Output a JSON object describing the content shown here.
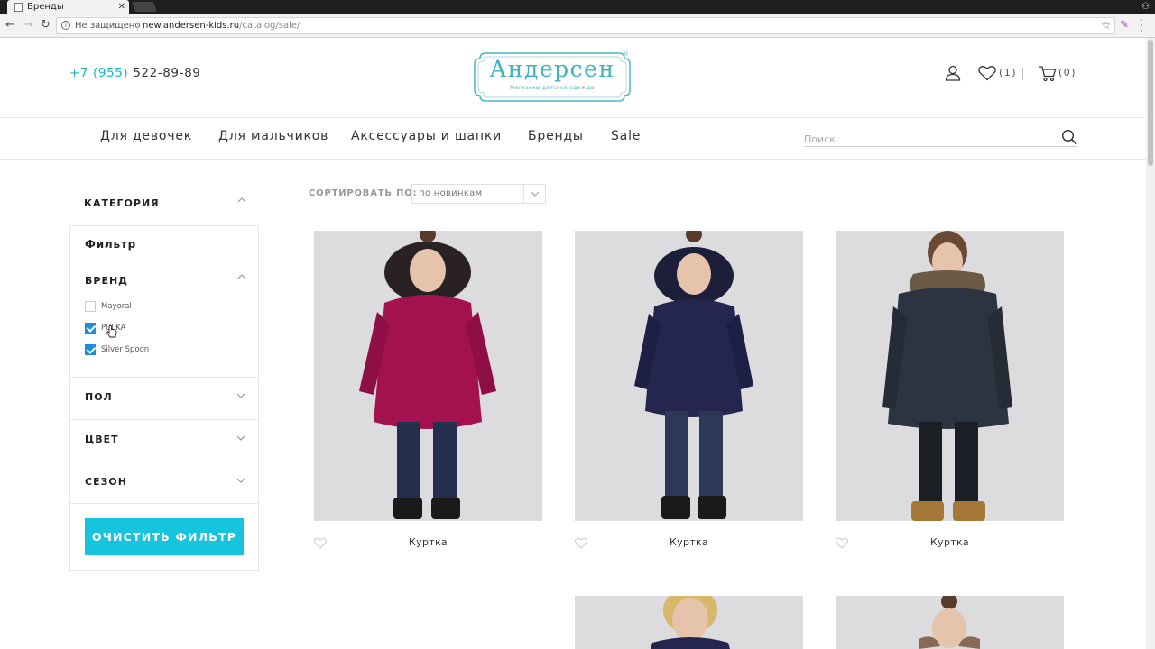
{
  "browser": {
    "tab_title": "Бренды",
    "security_text": "Не защищено",
    "url_host": "new.andersen-kids.ru",
    "url_path": "/catalog/sale/"
  },
  "header": {
    "phone_code": "+7 (955)",
    "phone_number": "522-89-89",
    "logo_text": "Андерсен",
    "logo_sub": "Магазины детской одежды",
    "logo_reg": "®",
    "wishlist_count": "(1)",
    "cart_count": "(0)"
  },
  "nav": {
    "items": [
      "Для девочек",
      "Для мальчиков",
      "Аксессуары и шапки",
      "Бренды",
      "Sale"
    ],
    "search_placeholder": "Поиск"
  },
  "sidebar": {
    "category_title": "КАТЕГОРИЯ",
    "filter_title": "Фильтр",
    "brand_title": "БРЕНД",
    "brands": [
      {
        "label": "Mayoral",
        "checked": false
      },
      {
        "label": "PULKA",
        "checked": true
      },
      {
        "label": "Silver Spoon",
        "checked": true
      }
    ],
    "gender_title": "ПОЛ",
    "color_title": "ЦВЕТ",
    "season_title": "СЕЗОН",
    "clear_button": "ОЧИСТИТЬ ФИЛЬТР"
  },
  "sort": {
    "label": "СОРТИРОВАТЬ ПО:",
    "value": "по новинкам"
  },
  "products": [
    {
      "name": "Куртка",
      "jacket_color": "#a3124f",
      "trim_color": "#2a2222"
    },
    {
      "name": "Куртка",
      "jacket_color": "#25264f",
      "trim_color": "#1d1f3a"
    },
    {
      "name": "Куртка",
      "jacket_color": "#2b3440",
      "trim_color": "#6b5a45"
    }
  ],
  "colors": {
    "accent": "#17c4de",
    "phone_accent": "#19b3c6",
    "logo": "#3fb3bd",
    "checkbox": "#1e8fd6"
  }
}
